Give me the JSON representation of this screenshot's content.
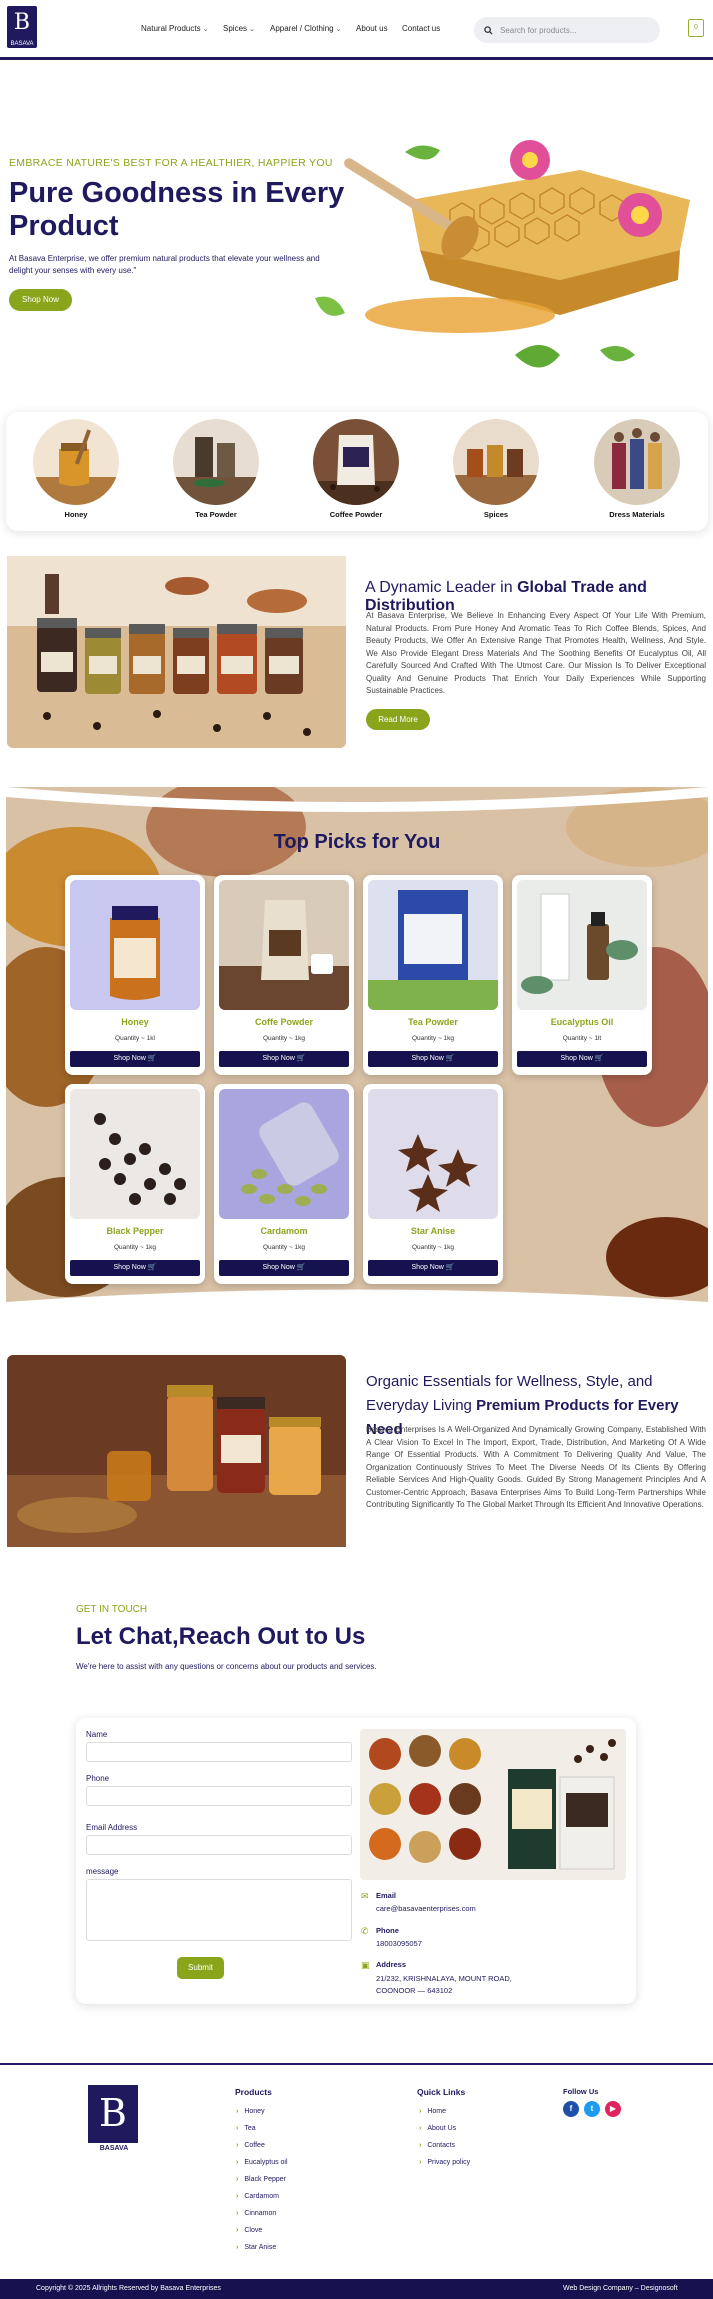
{
  "header": {
    "logo_text": "B",
    "logo_sub": "BASAVA",
    "nav": [
      {
        "label": "Natural Products",
        "has_dropdown": true
      },
      {
        "label": "Spices",
        "has_dropdown": true
      },
      {
        "label": "Apparel / Clothing",
        "has_dropdown": true
      },
      {
        "label": "About us",
        "has_dropdown": false
      },
      {
        "label": "Contact us",
        "has_dropdown": false
      }
    ],
    "search_placeholder": "Search for products...",
    "cart_count": "0"
  },
  "hero": {
    "tagline": "EMBRACE NATURE'S BEST FOR A HEALTHIER, HAPPIER YOU",
    "title": "Pure Goodness in Every Product",
    "description": "At Basava Enterprise, we offer premium natural products that elevate your wellness and delight your senses with every use.\"",
    "button": "Shop Now"
  },
  "categories": [
    {
      "label": "Honey"
    },
    {
      "label": "Tea Powder"
    },
    {
      "label": "Coffee Powder"
    },
    {
      "label": "Spices"
    },
    {
      "label": "Dress Materials"
    }
  ],
  "about": {
    "heading_light": "A Dynamic Leader in ",
    "heading_bold": "Global Trade and Distribution",
    "text": "At Basava Enterprise, We Believe In Enhancing Every Aspect Of Your Life With Premium, Natural Products. From Pure Honey And Aromatic Teas To Rich Coffee Blends, Spices, And Beauty Products, We Offer An Extensive Range That Promotes Health, Wellness, And Style. We Also Provide Elegant Dress Materials And The Soothing Benefits Of Eucalyptus Oil, All Carefully Sourced And Crafted With The Utmost Care. Our Mission Is To Deliver Exceptional Quality And Genuine Products That Enrich Your Daily Experiences While Supporting Sustainable Practices.",
    "button": "Read More"
  },
  "picks": {
    "title": "Top Picks for You",
    "products": [
      {
        "name": "Honey",
        "qty": "Quantity ~ 1kl",
        "shop": "Shop Now"
      },
      {
        "name": "Coffe Powder",
        "qty": "Quantity ~ 1kg",
        "shop": "Shop Now"
      },
      {
        "name": "Tea Powder",
        "qty": "Quantity ~ 1kg",
        "shop": "Shop Now"
      },
      {
        "name": "Eucalyptus Oil",
        "qty": "Quantity ~ 1lt",
        "shop": "Shop Now"
      },
      {
        "name": "Black Pepper",
        "qty": "Quantity ~ 1kg",
        "shop": "Shop Now"
      },
      {
        "name": "Cardamom",
        "qty": "Quantity ~ 1kg",
        "shop": "Shop Now"
      },
      {
        "name": "Star Anise",
        "qty": "Quantity ~ 1kg",
        "shop": "Shop Now"
      }
    ]
  },
  "premium": {
    "heading_light": "Organic Essentials for Wellness, Style, and Everyday Living ",
    "heading_bold": "Premium Products for Every Need",
    "text": "Basava Enterprises Is A Well-Organized And Dynamically Growing Company, Established With A Clear Vision To Excel In The Import, Export, Trade, Distribution, And Marketing Of A Wide Range Of Essential Products. With A Commitment To Delivering Quality And Value, The Organization Continuously Strives To Meet The Diverse Needs Of Its Clients By Offering Reliable Services And High-Quality Goods. Guided By Strong Management Principles And A Customer-Centric Approach, Basava Enterprises Aims To Build Long-Term Partnerships While Contributing Significantly To The Global Market Through Its Efficient And Innovative Operations."
  },
  "contact": {
    "eyebrow": "GET IN TOUCH",
    "title": "Let Chat,Reach Out to Us",
    "subtitle": "We're here to assist with any questions or concerns about our products and services.",
    "fields": {
      "name": "Name",
      "phone": "Phone",
      "email": "Email Address",
      "message": "message"
    },
    "submit": "Submit",
    "info": {
      "email_label": "Email",
      "email_value": "care@basavaenterprises.com",
      "phone_label": "Phone",
      "phone_value": "18003095057",
      "address_label": "Address",
      "address_line1": "21/232, KRISHNALAYA, MOUNT ROAD,",
      "address_line2": "COONOOR — 643102"
    }
  },
  "footer": {
    "logo_sub": "BASAVA",
    "products_title": "Products",
    "products": [
      "Honey",
      "Tea",
      "Coffee",
      "Eucalyptus oil",
      "Black Pepper",
      "Cardamom",
      "Cinnamon",
      "Clove",
      "Star Anise"
    ],
    "links_title": "Quick Links",
    "links": [
      "Home",
      "About Us",
      "Contacts",
      "Privacy policy"
    ],
    "follow_title": "Follow Us",
    "copyright": "Copyright © 2025 Allrights Reserved by Basava Enterprises",
    "credit": "Web Design Company – Designosoft"
  },
  "colors": {
    "brand": "#1f1a5e",
    "accent": "#89a51c",
    "button_dark": "#16124f"
  }
}
